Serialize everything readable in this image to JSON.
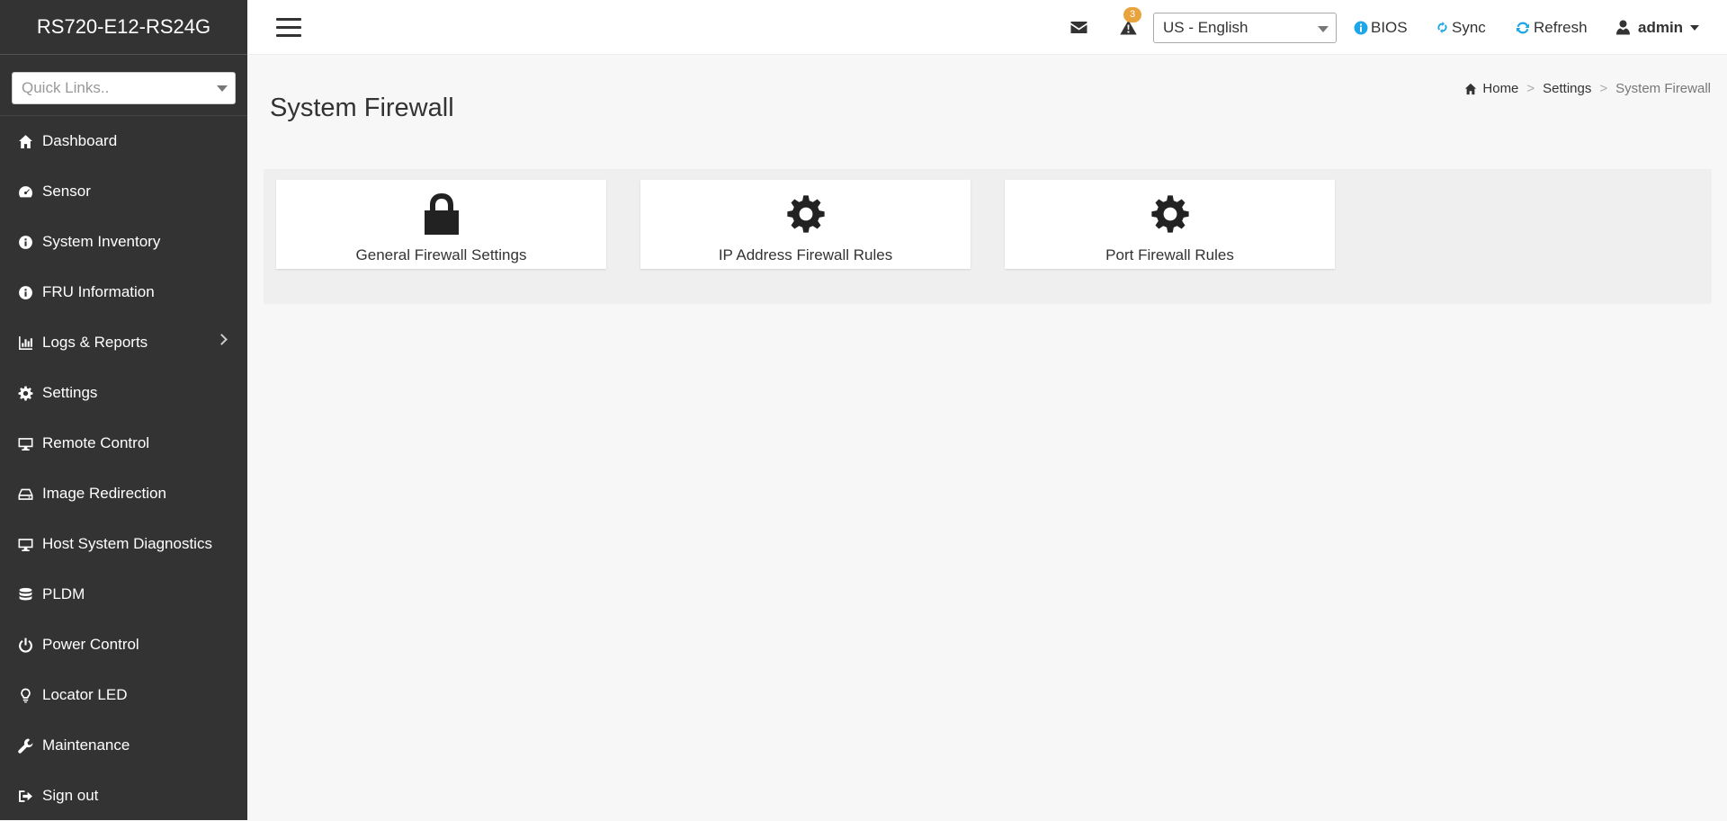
{
  "sidebar": {
    "brand": "RS720-E12-RS24G",
    "quick_links_placeholder": "Quick Links..",
    "items": [
      {
        "label": "Dashboard",
        "icon": "home-icon"
      },
      {
        "label": "Sensor",
        "icon": "gauge-icon"
      },
      {
        "label": "System Inventory",
        "icon": "info-icon"
      },
      {
        "label": "FRU Information",
        "icon": "info-icon"
      },
      {
        "label": "Logs & Reports",
        "icon": "bar-chart-icon"
      },
      {
        "label": "Settings",
        "icon": "gear-icon"
      },
      {
        "label": "Remote Control",
        "icon": "monitor-icon"
      },
      {
        "label": "Image Redirection",
        "icon": "drive-icon"
      },
      {
        "label": "Host System Diagnostics",
        "icon": "monitor-icon"
      },
      {
        "label": "PLDM",
        "icon": "database-icon"
      },
      {
        "label": "Power Control",
        "icon": "power-icon"
      },
      {
        "label": "Locator LED",
        "icon": "lightbulb-icon"
      },
      {
        "label": "Maintenance",
        "icon": "wrench-icon"
      },
      {
        "label": "Sign out",
        "icon": "sign-out-icon"
      }
    ]
  },
  "header": {
    "alert_count": "3",
    "language": "US - English",
    "bios_label": "BIOS",
    "sync_label": "Sync",
    "refresh_label": "Refresh",
    "user_label": "admin",
    "accent_color": "#1ea7e8",
    "badge_color": "#e8a33d"
  },
  "main": {
    "title": "System Firewall",
    "breadcrumb": {
      "home": "Home",
      "settings": "Settings",
      "current": "System Firewall",
      "separator": ">"
    },
    "cards": [
      {
        "label": "General Firewall Settings",
        "icon": "lock-icon"
      },
      {
        "label": "IP Address Firewall Rules",
        "icon": "gear-icon"
      },
      {
        "label": "Port Firewall Rules",
        "icon": "gear-icon"
      }
    ]
  }
}
